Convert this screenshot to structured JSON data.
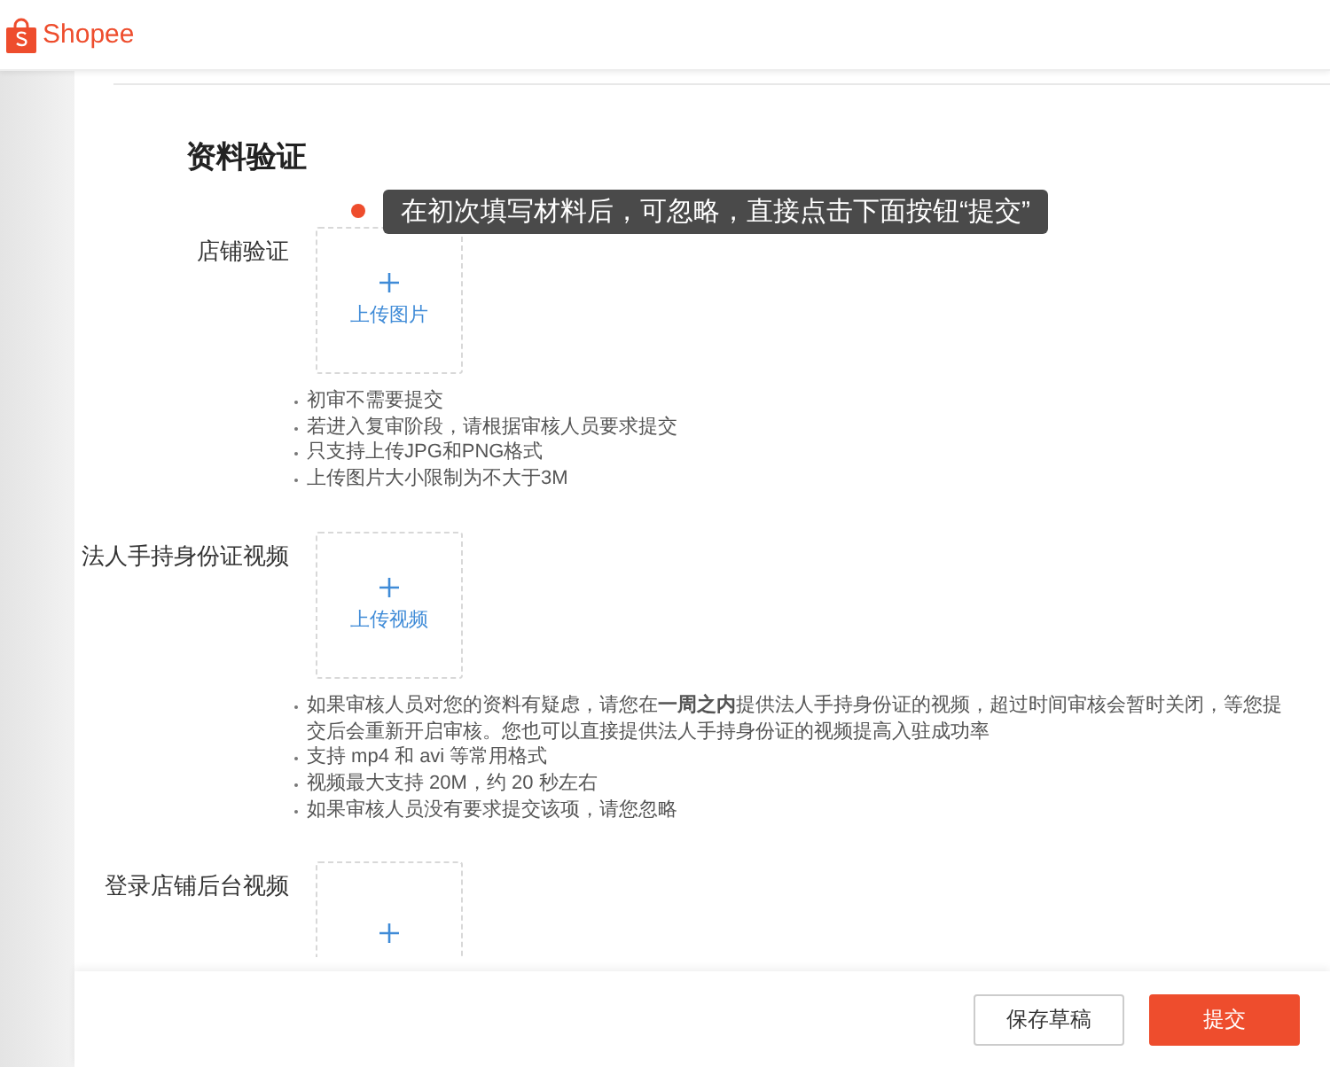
{
  "brand": {
    "name": "Shopee"
  },
  "title": "资料验证",
  "sections": [
    {
      "label": "店铺验证",
      "upload": "上传图片",
      "required_dot": true,
      "tooltip": "在初次填写材料后，可忽略，直接点击下面按钮“提交”",
      "notes": [
        "初审不需要提交",
        "若进入复审阶段，请根据审核人员要求提交",
        "只支持上传JPG和PNG格式",
        "上传图片大小限制为不大于3M"
      ]
    },
    {
      "label": "法人手持身份证视频",
      "upload": "上传视频",
      "required_dot": false,
      "notes": [
        "如果审核人员对您的资料有疑虑，请您在**一周之内**提供法人手持身份证的视频，超过时间审核会暂时关闭，等您提交后会重新开启审核。您也可以直接提供法人手持身份证的视频提高入驻成功率",
        "支持 mp4 和 avi 等常用格式",
        "视频最大支持 20M，约 20 秒左右",
        "如果审核人员没有要求提交该项，请您忽略"
      ]
    },
    {
      "label": "登录店铺后台视频",
      "required_dot": false
    }
  ],
  "buttons": [
    {
      "label": "保存草稿",
      "kind": "secondary"
    },
    {
      "label": "提交",
      "kind": "primary"
    }
  ]
}
